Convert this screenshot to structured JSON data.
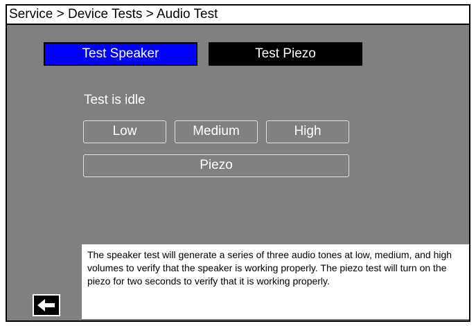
{
  "header": {
    "breadcrumb": "Service > Device Tests > Audio Test"
  },
  "modes": {
    "speaker_label": "Test Speaker",
    "piezo_label": "Test Piezo"
  },
  "status": {
    "text": "Test is idle"
  },
  "tones": {
    "low": "Low",
    "medium": "Medium",
    "high": "High",
    "piezo": "Piezo"
  },
  "info": {
    "text": "The speaker test will generate a series of three audio tones at low, medium, and high volumes to verify that the speaker is working properly.  The piezo test will turn on the piezo for two seconds to verify that it is working properly."
  },
  "navigation": {
    "back_icon": "arrow-left-icon"
  },
  "colors": {
    "background": "#808080",
    "selected_tab": "#0000ff",
    "unselected_tab": "#000000"
  }
}
